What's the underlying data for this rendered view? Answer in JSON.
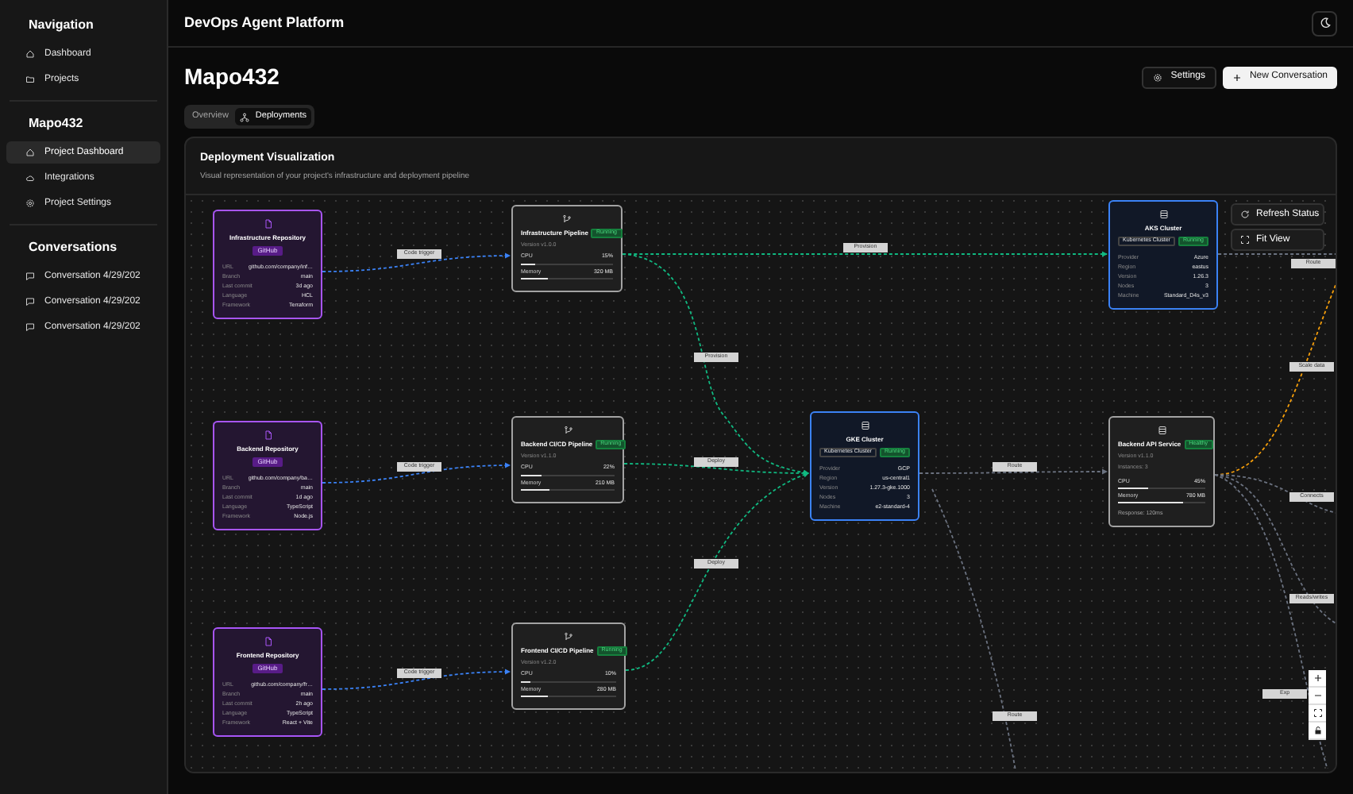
{
  "sidebar": {
    "sections": [
      {
        "title": "Navigation",
        "items": [
          {
            "label": "Dashboard",
            "selected": false
          },
          {
            "label": "Projects",
            "selected": false
          }
        ]
      },
      {
        "title": "Mapo432",
        "items": [
          {
            "label": "Project Dashboard",
            "selected": true
          },
          {
            "label": "Integrations",
            "selected": false
          },
          {
            "label": "Project Settings",
            "selected": false
          }
        ]
      },
      {
        "title": "Conversations",
        "items": [
          {
            "label": "Conversation 4/29/202",
            "selected": false
          },
          {
            "label": "Conversation 4/29/202",
            "selected": false
          },
          {
            "label": "Conversation 4/29/202",
            "selected": false
          }
        ]
      }
    ]
  },
  "header": {
    "title": "DevOps Agent Platform"
  },
  "project": {
    "title": "Mapo432",
    "actions": [
      {
        "label": "Settings",
        "kind": "secondary"
      },
      {
        "label": "New Conversation",
        "kind": "primary"
      }
    ]
  },
  "tabs": [
    {
      "label": "Overview",
      "selected": false
    },
    {
      "label": "Deployments",
      "selected": true
    }
  ],
  "visualization": {
    "title": "Deployment Visualization",
    "subtitle": "Visual representation of your project's infrastructure and deployment pipeline",
    "controls": [
      "Refresh Status",
      "Fit View"
    ],
    "nodes": [
      {
        "kind": "repository",
        "title": "Infrastructure Repository",
        "badge": "GitHub",
        "fields": [
          {
            "label": "URL",
            "value": "github.com/company/inf…"
          },
          {
            "label": "Branch",
            "value": "main"
          },
          {
            "label": "Last commit",
            "value": "3d ago"
          },
          {
            "label": "Language",
            "value": "HCL"
          },
          {
            "label": "Framework",
            "value": "Terraform"
          }
        ]
      },
      {
        "kind": "pipeline",
        "title": "Infrastructure Pipeline",
        "status": "Running",
        "version": "Version v1.0.0",
        "metrics": [
          {
            "label": "CPU",
            "value": "15%",
            "level": 0.15
          },
          {
            "label": "Memory",
            "value": "320 MB",
            "level": 0.3
          }
        ]
      },
      {
        "kind": "cluster",
        "title": "AKS Cluster",
        "type": "Kubernetes Cluster",
        "status": "Running",
        "fields": [
          {
            "label": "Provider",
            "value": "Azure"
          },
          {
            "label": "Region",
            "value": "eastus"
          },
          {
            "label": "Version",
            "value": "1.26.3"
          },
          {
            "label": "Nodes",
            "value": "3"
          },
          {
            "label": "Machine",
            "value": "Standard_D4s_v3"
          }
        ]
      },
      {
        "kind": "repository",
        "title": "Backend Repository",
        "badge": "GitHub",
        "fields": [
          {
            "label": "URL",
            "value": "github.com/company/ba…"
          },
          {
            "label": "Branch",
            "value": "main"
          },
          {
            "label": "Last commit",
            "value": "1d ago"
          },
          {
            "label": "Language",
            "value": "TypeScript"
          },
          {
            "label": "Framework",
            "value": "Node.js"
          }
        ]
      },
      {
        "kind": "pipeline",
        "title": "Backend CI/CD Pipeline",
        "status": "Running",
        "version": "Version v1.1.0",
        "metrics": [
          {
            "label": "CPU",
            "value": "22%",
            "level": 0.22
          },
          {
            "label": "Memory",
            "value": "210 MB",
            "level": 0.3
          }
        ]
      },
      {
        "kind": "cluster",
        "title": "GKE Cluster",
        "type": "Kubernetes Cluster",
        "status": "Running",
        "fields": [
          {
            "label": "Provider",
            "value": "GCP"
          },
          {
            "label": "Region",
            "value": "us-central1"
          },
          {
            "label": "Version",
            "value": "1.27.3-gke.1000"
          },
          {
            "label": "Nodes",
            "value": "3"
          },
          {
            "label": "Machine",
            "value": "e2-standard-4"
          }
        ]
      },
      {
        "kind": "service",
        "title": "Backend API Service",
        "status": "Healthy",
        "version": "Version v1.1.0",
        "instances": "Instances: 3",
        "metrics": [
          {
            "label": "CPU",
            "value": "45%",
            "level": 0.35
          },
          {
            "label": "Memory",
            "value": "780 MB",
            "level": 0.75
          }
        ],
        "response": "Response: 120ms"
      },
      {
        "kind": "repository",
        "title": "Frontend Repository",
        "badge": "GitHub",
        "fields": [
          {
            "label": "URL",
            "value": "github.com/company/fr…"
          },
          {
            "label": "Branch",
            "value": "main"
          },
          {
            "label": "Last commit",
            "value": "2h ago"
          },
          {
            "label": "Language",
            "value": "TypeScript"
          },
          {
            "label": "Framework",
            "value": "React + Vite"
          }
        ]
      },
      {
        "kind": "pipeline",
        "title": "Frontend CI/CD Pipeline",
        "status": "Running",
        "version": "Version v1.2.0",
        "metrics": [
          {
            "label": "CPU",
            "value": "10%",
            "level": 0.1
          },
          {
            "label": "Memory",
            "value": "280 MB",
            "level": 0.28
          }
        ]
      }
    ],
    "edge_labels": [
      "Code trigger",
      "Provision",
      "Route",
      "Provision",
      "Scale data",
      "Code trigger",
      "Deploy",
      "Route",
      "Connects",
      "Deploy",
      "Reads/writes",
      "Code trigger",
      "Exp",
      "Route"
    ]
  }
}
